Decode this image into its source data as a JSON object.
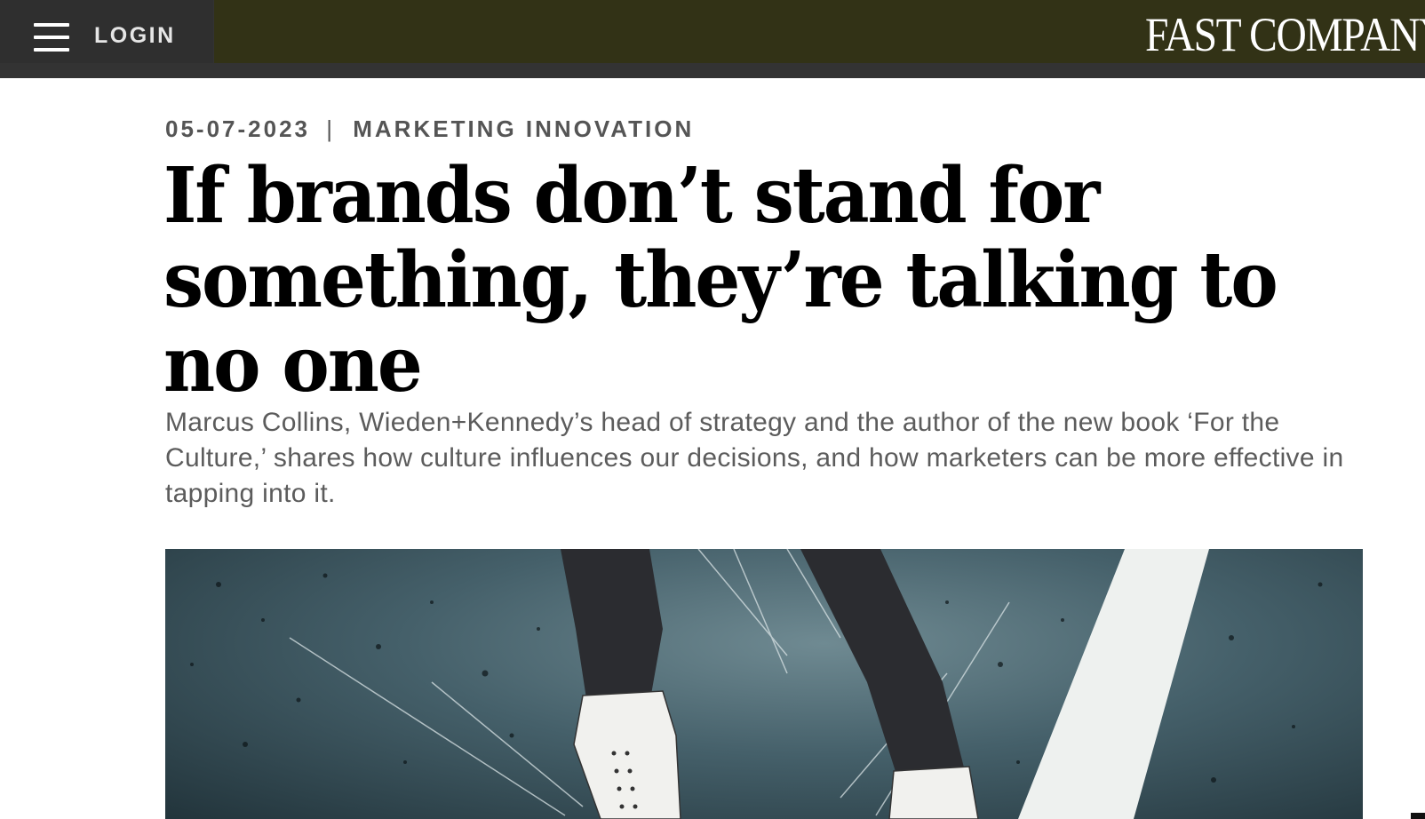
{
  "header": {
    "menu_icon": "hamburger-menu-icon",
    "login_label": "LOGIN",
    "logo_text": "FAST COMPANY"
  },
  "article": {
    "date": "05-07-2023",
    "separator": "|",
    "category": "MARKETING INNOVATION",
    "headline": "If brands don’t stand for something, they’re talking to no one",
    "dek": "Marcus Collins, Wieden+Kennedy’s head of strategy and the author of the new book ‘For the Culture,’ shares how culture influences our decisions, and how marketers can be more effective in tapping into it.",
    "hero_image": "illustration-legs-white-boots-splatter"
  },
  "colors": {
    "header_dark": "#333333",
    "header_brand": "#323216",
    "text_meta": "#555555",
    "text_dek": "#5c5c5c",
    "headline": "#000000"
  }
}
